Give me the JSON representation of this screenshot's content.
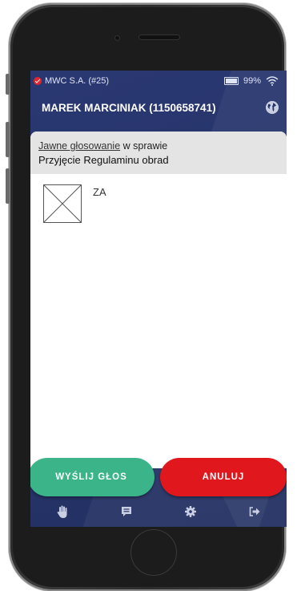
{
  "status_bar": {
    "carrier": "MWC S.A. (#25)",
    "battery": "99%"
  },
  "header": {
    "title": "MAREK MARCINIAK (1150658741)"
  },
  "vote": {
    "type_link": "Jawne głosowanie",
    "type_suffix": " w sprawie",
    "subject": "Przyjęcie Regulaminu obrad",
    "option_label": "ZA",
    "option_checked": false
  },
  "actions": {
    "send_label": "WYŚLIJ GŁOS",
    "cancel_label": "ANULUJ"
  },
  "colors": {
    "background": "#27346a",
    "send": "#3bb48a",
    "cancel": "#e0181e",
    "status_error": "#e0262e"
  },
  "bottom_nav": [
    {
      "icon": "hand-icon"
    },
    {
      "icon": "message-icon"
    },
    {
      "icon": "gear-icon"
    },
    {
      "icon": "logout-icon"
    }
  ]
}
